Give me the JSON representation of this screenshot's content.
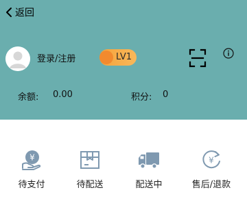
{
  "colors": {
    "header_bg": "#6aaeae",
    "icon_color": "#7f99b0",
    "level_badge": "#f6a33b"
  },
  "nav": {
    "back_label": "返回",
    "back_icon": "chevron-left-icon"
  },
  "profile": {
    "login_label": "登录/注册",
    "level_label": "LV1",
    "scan_icon": "scan-icon",
    "info_icon": "info-icon"
  },
  "account": {
    "balance_label": "余额:",
    "balance_value": "0.00",
    "points_label": "积分:",
    "points_value": "0"
  },
  "orders": [
    {
      "label": "待支付",
      "icon": "payment-icon"
    },
    {
      "label": "待配送",
      "icon": "package-icon"
    },
    {
      "label": "配送中",
      "icon": "delivery-truck-icon"
    },
    {
      "label": "售后/退款",
      "icon": "refund-icon"
    }
  ]
}
